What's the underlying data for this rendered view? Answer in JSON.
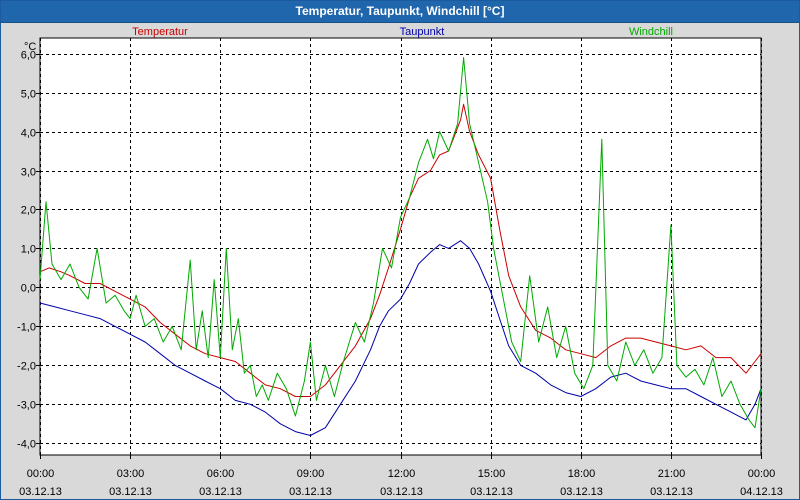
{
  "window": {
    "title": "Temperatur, Taupunkt, Windchill [°C]"
  },
  "chart_data": {
    "type": "line",
    "title": "Temperatur, Taupunkt, Windchill [°C]",
    "ylabel": "°C",
    "ylim": [
      -4.3,
      6.4
    ],
    "yticks": [
      "6,0",
      "5,0",
      "4,0",
      "3,0",
      "2,0",
      "1,0",
      "0,0",
      "-1,0",
      "-2,0",
      "-3,0",
      "-4,0"
    ],
    "ytick_values": [
      6,
      5,
      4,
      3,
      2,
      1,
      0,
      -1,
      -2,
      -3,
      -4
    ],
    "xlim": [
      0,
      24
    ],
    "xticks": [
      {
        "time": "00:00",
        "date": "03.12.13"
      },
      {
        "time": "03:00",
        "date": "03.12.13"
      },
      {
        "time": "06:00",
        "date": "03.12.13"
      },
      {
        "time": "09:00",
        "date": "03.12.13"
      },
      {
        "time": "12:00",
        "date": "03.12.13"
      },
      {
        "time": "15:00",
        "date": "03.12.13"
      },
      {
        "time": "18:00",
        "date": "03.12.13"
      },
      {
        "time": "21:00",
        "date": "03.12.13"
      },
      {
        "time": "00:00",
        "date": "04.12.13"
      }
    ],
    "xtick_values": [
      0,
      3,
      6,
      9,
      12,
      15,
      18,
      21,
      24
    ],
    "grid": true,
    "legend_position": "top",
    "series": [
      {
        "name": "Temperatur",
        "color": "#cc0000",
        "points": [
          [
            0,
            0.4
          ],
          [
            0.3,
            0.5
          ],
          [
            0.7,
            0.4
          ],
          [
            1,
            0.3
          ],
          [
            1.5,
            0.1
          ],
          [
            2,
            0.1
          ],
          [
            2.5,
            -0.1
          ],
          [
            3,
            -0.3
          ],
          [
            3.5,
            -0.5
          ],
          [
            4,
            -0.9
          ],
          [
            4.5,
            -1.2
          ],
          [
            5,
            -1.5
          ],
          [
            5.5,
            -1.7
          ],
          [
            6,
            -1.8
          ],
          [
            6.5,
            -1.9
          ],
          [
            7,
            -2.2
          ],
          [
            7.5,
            -2.5
          ],
          [
            8,
            -2.6
          ],
          [
            8.5,
            -2.8
          ],
          [
            9,
            -2.8
          ],
          [
            9.5,
            -2.5
          ],
          [
            10,
            -2.0
          ],
          [
            10.5,
            -1.5
          ],
          [
            11,
            -0.8
          ],
          [
            11.3,
            -0.2
          ],
          [
            11.6,
            0.5
          ],
          [
            12,
            1.5
          ],
          [
            12.3,
            2.3
          ],
          [
            12.6,
            2.8
          ],
          [
            13,
            3.0
          ],
          [
            13.3,
            3.4
          ],
          [
            13.6,
            3.5
          ],
          [
            13.8,
            3.9
          ],
          [
            14,
            4.3
          ],
          [
            14.1,
            4.7
          ],
          [
            14.3,
            4.0
          ],
          [
            14.6,
            3.4
          ],
          [
            15,
            2.8
          ],
          [
            15.3,
            1.5
          ],
          [
            15.6,
            0.3
          ],
          [
            16,
            -0.5
          ],
          [
            16.5,
            -1.1
          ],
          [
            17,
            -1.3
          ],
          [
            17.5,
            -1.6
          ],
          [
            18,
            -1.7
          ],
          [
            18.5,
            -1.8
          ],
          [
            19,
            -1.5
          ],
          [
            19.5,
            -1.3
          ],
          [
            20,
            -1.3
          ],
          [
            20.5,
            -1.4
          ],
          [
            21,
            -1.5
          ],
          [
            21.5,
            -1.6
          ],
          [
            22,
            -1.5
          ],
          [
            22.5,
            -1.8
          ],
          [
            23,
            -1.8
          ],
          [
            23.5,
            -2.2
          ],
          [
            23.8,
            -1.9
          ],
          [
            24,
            -1.7
          ]
        ]
      },
      {
        "name": "Taupunkt",
        "color": "#0000aa",
        "points": [
          [
            0,
            -0.4
          ],
          [
            0.5,
            -0.5
          ],
          [
            1,
            -0.6
          ],
          [
            1.5,
            -0.7
          ],
          [
            2,
            -0.8
          ],
          [
            2.5,
            -1.0
          ],
          [
            3,
            -1.2
          ],
          [
            3.5,
            -1.4
          ],
          [
            4,
            -1.7
          ],
          [
            4.5,
            -2.0
          ],
          [
            5,
            -2.2
          ],
          [
            5.5,
            -2.4
          ],
          [
            6,
            -2.6
          ],
          [
            6.5,
            -2.9
          ],
          [
            7,
            -3.0
          ],
          [
            7.5,
            -3.2
          ],
          [
            8,
            -3.5
          ],
          [
            8.5,
            -3.7
          ],
          [
            9,
            -3.8
          ],
          [
            9.5,
            -3.6
          ],
          [
            10,
            -3.0
          ],
          [
            10.5,
            -2.4
          ],
          [
            11,
            -1.6
          ],
          [
            11.3,
            -1.0
          ],
          [
            11.6,
            -0.6
          ],
          [
            12,
            -0.3
          ],
          [
            12.3,
            0.1
          ],
          [
            12.6,
            0.6
          ],
          [
            13,
            0.9
          ],
          [
            13.3,
            1.1
          ],
          [
            13.6,
            1.0
          ],
          [
            14,
            1.2
          ],
          [
            14.3,
            1.0
          ],
          [
            14.6,
            0.6
          ],
          [
            15,
            -0.1
          ],
          [
            15.3,
            -0.8
          ],
          [
            15.6,
            -1.5
          ],
          [
            16,
            -2.0
          ],
          [
            16.5,
            -2.2
          ],
          [
            17,
            -2.5
          ],
          [
            17.5,
            -2.7
          ],
          [
            18,
            -2.8
          ],
          [
            18.5,
            -2.6
          ],
          [
            19,
            -2.3
          ],
          [
            19.5,
            -2.2
          ],
          [
            20,
            -2.4
          ],
          [
            20.5,
            -2.5
          ],
          [
            21,
            -2.6
          ],
          [
            21.5,
            -2.6
          ],
          [
            22,
            -2.8
          ],
          [
            22.5,
            -3.0
          ],
          [
            23,
            -3.2
          ],
          [
            23.5,
            -3.4
          ],
          [
            23.8,
            -3.0
          ],
          [
            24,
            -2.6
          ]
        ]
      },
      {
        "name": "Windchill",
        "color": "#00aa00",
        "points": [
          [
            0,
            0.2
          ],
          [
            0.2,
            2.2
          ],
          [
            0.4,
            0.6
          ],
          [
            0.7,
            0.2
          ],
          [
            1,
            0.6
          ],
          [
            1.3,
            0.0
          ],
          [
            1.6,
            -0.3
          ],
          [
            1.9,
            1.0
          ],
          [
            2.2,
            -0.4
          ],
          [
            2.5,
            -0.2
          ],
          [
            2.8,
            -0.6
          ],
          [
            3,
            -0.8
          ],
          [
            3.2,
            -0.2
          ],
          [
            3.5,
            -1.0
          ],
          [
            3.8,
            -0.8
          ],
          [
            4.1,
            -1.4
          ],
          [
            4.4,
            -1.0
          ],
          [
            4.7,
            -1.6
          ],
          [
            5,
            0.7
          ],
          [
            5.2,
            -1.6
          ],
          [
            5.4,
            -0.6
          ],
          [
            5.6,
            -1.8
          ],
          [
            5.8,
            0.2
          ],
          [
            6.0,
            -1.8
          ],
          [
            6.2,
            1.0
          ],
          [
            6.4,
            -1.6
          ],
          [
            6.6,
            -0.8
          ],
          [
            6.8,
            -2.2
          ],
          [
            7.0,
            -2.0
          ],
          [
            7.2,
            -2.8
          ],
          [
            7.4,
            -2.5
          ],
          [
            7.6,
            -2.9
          ],
          [
            7.9,
            -2.2
          ],
          [
            8.2,
            -2.6
          ],
          [
            8.5,
            -3.3
          ],
          [
            8.8,
            -2.4
          ],
          [
            9,
            -1.4
          ],
          [
            9.2,
            -2.9
          ],
          [
            9.5,
            -2.0
          ],
          [
            9.8,
            -2.8
          ],
          [
            10.1,
            -1.9
          ],
          [
            10.5,
            -0.9
          ],
          [
            10.8,
            -1.4
          ],
          [
            11.1,
            -0.4
          ],
          [
            11.4,
            1.0
          ],
          [
            11.7,
            0.5
          ],
          [
            12,
            1.8
          ],
          [
            12.3,
            2.3
          ],
          [
            12.6,
            3.2
          ],
          [
            12.9,
            3.8
          ],
          [
            13.1,
            3.3
          ],
          [
            13.3,
            4.0
          ],
          [
            13.6,
            3.5
          ],
          [
            13.9,
            4.2
          ],
          [
            14.1,
            5.9
          ],
          [
            14.3,
            4.2
          ],
          [
            14.6,
            3.2
          ],
          [
            14.9,
            2.2
          ],
          [
            15.1,
            1.0
          ],
          [
            15.4,
            -0.2
          ],
          [
            15.7,
            -1.4
          ],
          [
            16.0,
            -1.9
          ],
          [
            16.3,
            0.3
          ],
          [
            16.6,
            -1.4
          ],
          [
            16.9,
            -0.5
          ],
          [
            17.2,
            -1.8
          ],
          [
            17.5,
            -1.0
          ],
          [
            17.8,
            -2.2
          ],
          [
            18.1,
            -2.6
          ],
          [
            18.4,
            -2.0
          ],
          [
            18.7,
            3.8
          ],
          [
            18.9,
            -2.0
          ],
          [
            19.2,
            -2.4
          ],
          [
            19.5,
            -1.4
          ],
          [
            19.8,
            -2.0
          ],
          [
            20.1,
            -1.6
          ],
          [
            20.4,
            -2.2
          ],
          [
            20.7,
            -1.8
          ],
          [
            21,
            1.6
          ],
          [
            21.2,
            -2.0
          ],
          [
            21.5,
            -2.3
          ],
          [
            21.8,
            -2.1
          ],
          [
            22.1,
            -2.5
          ],
          [
            22.4,
            -1.8
          ],
          [
            22.7,
            -2.8
          ],
          [
            23,
            -2.4
          ],
          [
            23.3,
            -3.0
          ],
          [
            23.6,
            -3.4
          ],
          [
            23.8,
            -3.6
          ],
          [
            24,
            -2.6
          ]
        ]
      }
    ]
  }
}
